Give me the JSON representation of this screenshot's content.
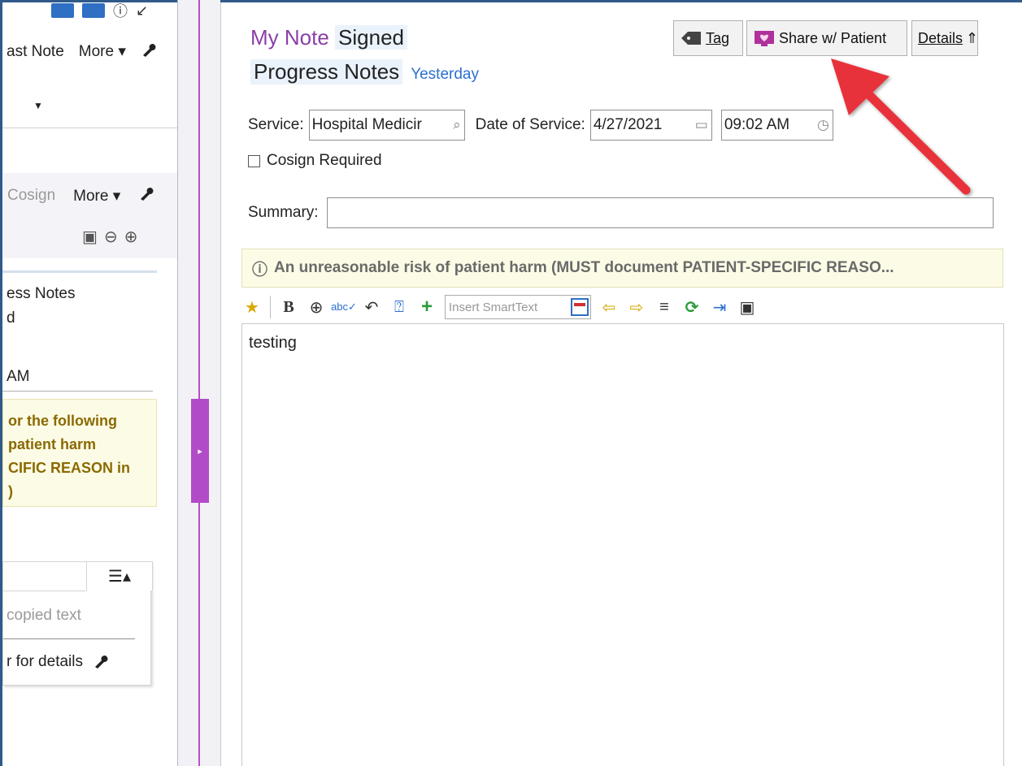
{
  "left_panel": {
    "last_note_label": "ast Note",
    "more1_label": "More",
    "cosign_label": "Cosign",
    "more2_label": "More",
    "note_type_partial": "ess Notes",
    "note_status_partial": "d",
    "time_partial": "AM",
    "warning_lines": [
      "or the following",
      "patient harm",
      "CIFIC REASON in",
      ")"
    ],
    "copied_text_placeholder": "copied text",
    "details_partial": "r for details"
  },
  "note": {
    "title_prefix": "My Note",
    "status": "Signed",
    "note_type": "Progress Notes",
    "when": "Yesterday",
    "buttons": {
      "tag": "Tag",
      "share": "Share w/ Patient",
      "details": "Details"
    },
    "service_label": "Service:",
    "service_value": "Hospital Medicir",
    "date_label": "Date of Service:",
    "date_value": "4/27/2021",
    "time_value": "09:02 AM",
    "cosign_label": "Cosign Required",
    "summary_label": "Summary:",
    "summary_value": "",
    "banner_text": "An unreasonable risk of patient harm (MUST document PATIENT-SPECIFIC REASO...",
    "smarttext_placeholder": "Insert SmartText",
    "editor_text": "testing"
  },
  "colors": {
    "accent_purple": "#8b3fa8",
    "handle_purple": "#b14bc7",
    "arrow_red": "#e8323a",
    "link_blue": "#2c6fd0",
    "banner_bg": "#fcfce6"
  }
}
